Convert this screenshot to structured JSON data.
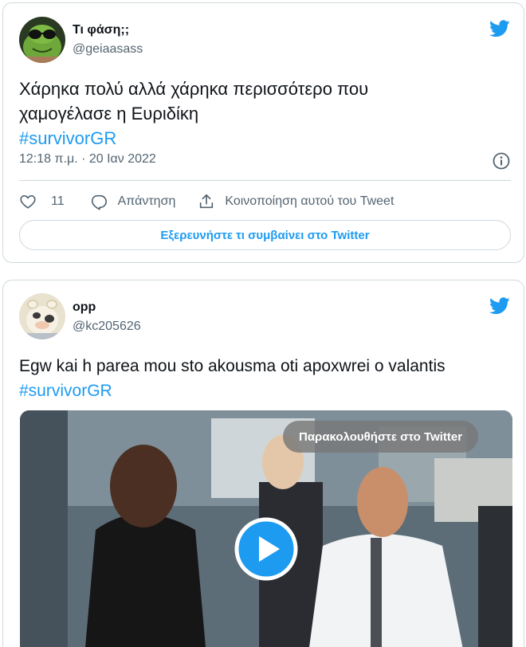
{
  "tweets": [
    {
      "author_name": "Τι φάση;;",
      "author_handle": "@geiaasass",
      "text_line1": "Χάρηκα πολύ αλλά χάρηκα περισσότερο που",
      "text_line2": "χαμογέλασε η Ευριδίκη",
      "hashtag": "#survivorGR",
      "timestamp": "12:18 π.μ. · 20 Ιαν 2022",
      "like_count": "11",
      "reply_label": "Απάντηση",
      "share_label": "Κοινοποίηση αυτού του Tweet",
      "explore_label": "Εξερευνήστε τι συμβαίνει στο Twitter"
    },
    {
      "author_name": "opp",
      "author_handle": "@kc205626",
      "text_line1": "Egw kai h parea mou sto akousma oti apoxwrei o valantis",
      "hashtag": "#survivorGR",
      "media_watch_label": "Παρακολουθήστε στο Twitter"
    }
  ],
  "icons": {
    "brand": "twitter-bird-icon",
    "info": "info-icon",
    "like": "heart-icon",
    "reply": "reply-bubble-icon",
    "share": "share-icon",
    "play": "play-icon"
  },
  "colors": {
    "accent": "#1d9bf0",
    "text": "#0f1419",
    "secondary": "#536471",
    "border": "#cfd9de"
  }
}
